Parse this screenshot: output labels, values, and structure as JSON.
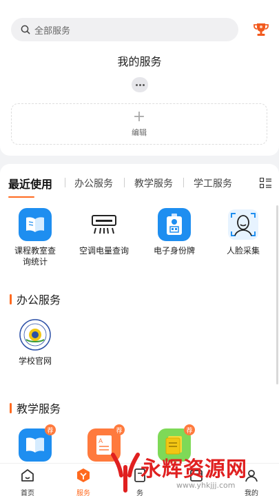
{
  "search": {
    "placeholder": "全部服务"
  },
  "my_services": {
    "title": "我的服务",
    "edit_label": "编辑"
  },
  "tabs": [
    {
      "label": "最近使用",
      "active": true
    },
    {
      "label": "办公服务",
      "active": false
    },
    {
      "label": "教学服务",
      "active": false
    },
    {
      "label": "学工服务",
      "active": false
    }
  ],
  "recent_apps": [
    {
      "label": "课程教室查询统计",
      "icon": "book-icon"
    },
    {
      "label": "空调电量查询",
      "icon": "air-conditioner-icon"
    },
    {
      "label": "电子身份牌",
      "icon": "id-badge-icon"
    },
    {
      "label": "人脸采集",
      "icon": "face-scan-icon"
    }
  ],
  "office_section": {
    "title": "办公服务",
    "apps": [
      {
        "label": "学校官网",
        "icon": "school-logo-icon"
      }
    ]
  },
  "teaching_section": {
    "title": "教学服务",
    "apps": [
      {
        "icon": "book-icon",
        "badge": "荐"
      },
      {
        "icon": "document-icon",
        "badge": "荐"
      },
      {
        "icon": "notes-icon",
        "badge": "荐"
      }
    ]
  },
  "bottom_nav": [
    {
      "label": "首页",
      "icon": "home-icon",
      "active": false
    },
    {
      "label": "服务",
      "icon": "service-cube-icon",
      "active": true
    },
    {
      "label": "务",
      "icon": "tasks-icon",
      "active": false
    },
    {
      "label": "",
      "icon": "calendar-icon",
      "active": false
    },
    {
      "label": "我的",
      "icon": "profile-icon",
      "active": false
    }
  ],
  "watermark": {
    "text": "永辉资源网",
    "url": "www.yhkjjj.com"
  },
  "colors": {
    "accent": "#ff6a1f",
    "blue": "#1e8ef0",
    "orange": "#ff7a3d",
    "green": "#7ed957"
  }
}
